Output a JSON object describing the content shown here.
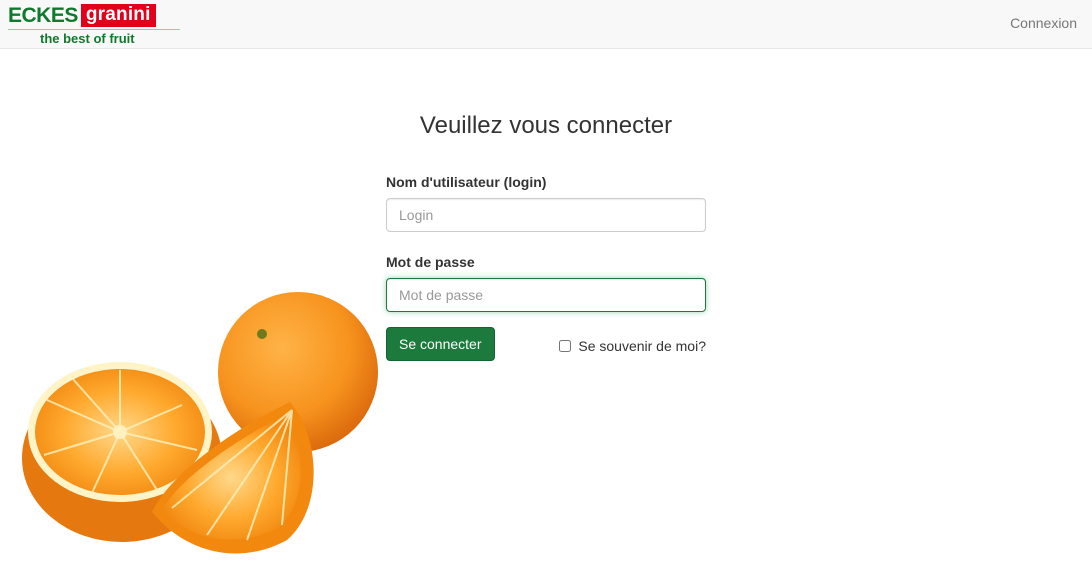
{
  "header": {
    "logo": {
      "brand_primary": "ECKES",
      "brand_secondary": "granini",
      "tagline": "the best of fruit"
    },
    "nav_link": "Connexion"
  },
  "main": {
    "title": "Veuillez vous connecter",
    "username_label": "Nom d'utilisateur (login)",
    "username_placeholder": "Login",
    "password_label": "Mot de passe",
    "password_placeholder": "Mot de passe",
    "submit_label": "Se connecter",
    "remember_label": "Se souvenir de moi?"
  },
  "colors": {
    "brand_green": "#0f7a2e",
    "brand_red": "#e2001a",
    "button_green": "#1b7a3c"
  }
}
